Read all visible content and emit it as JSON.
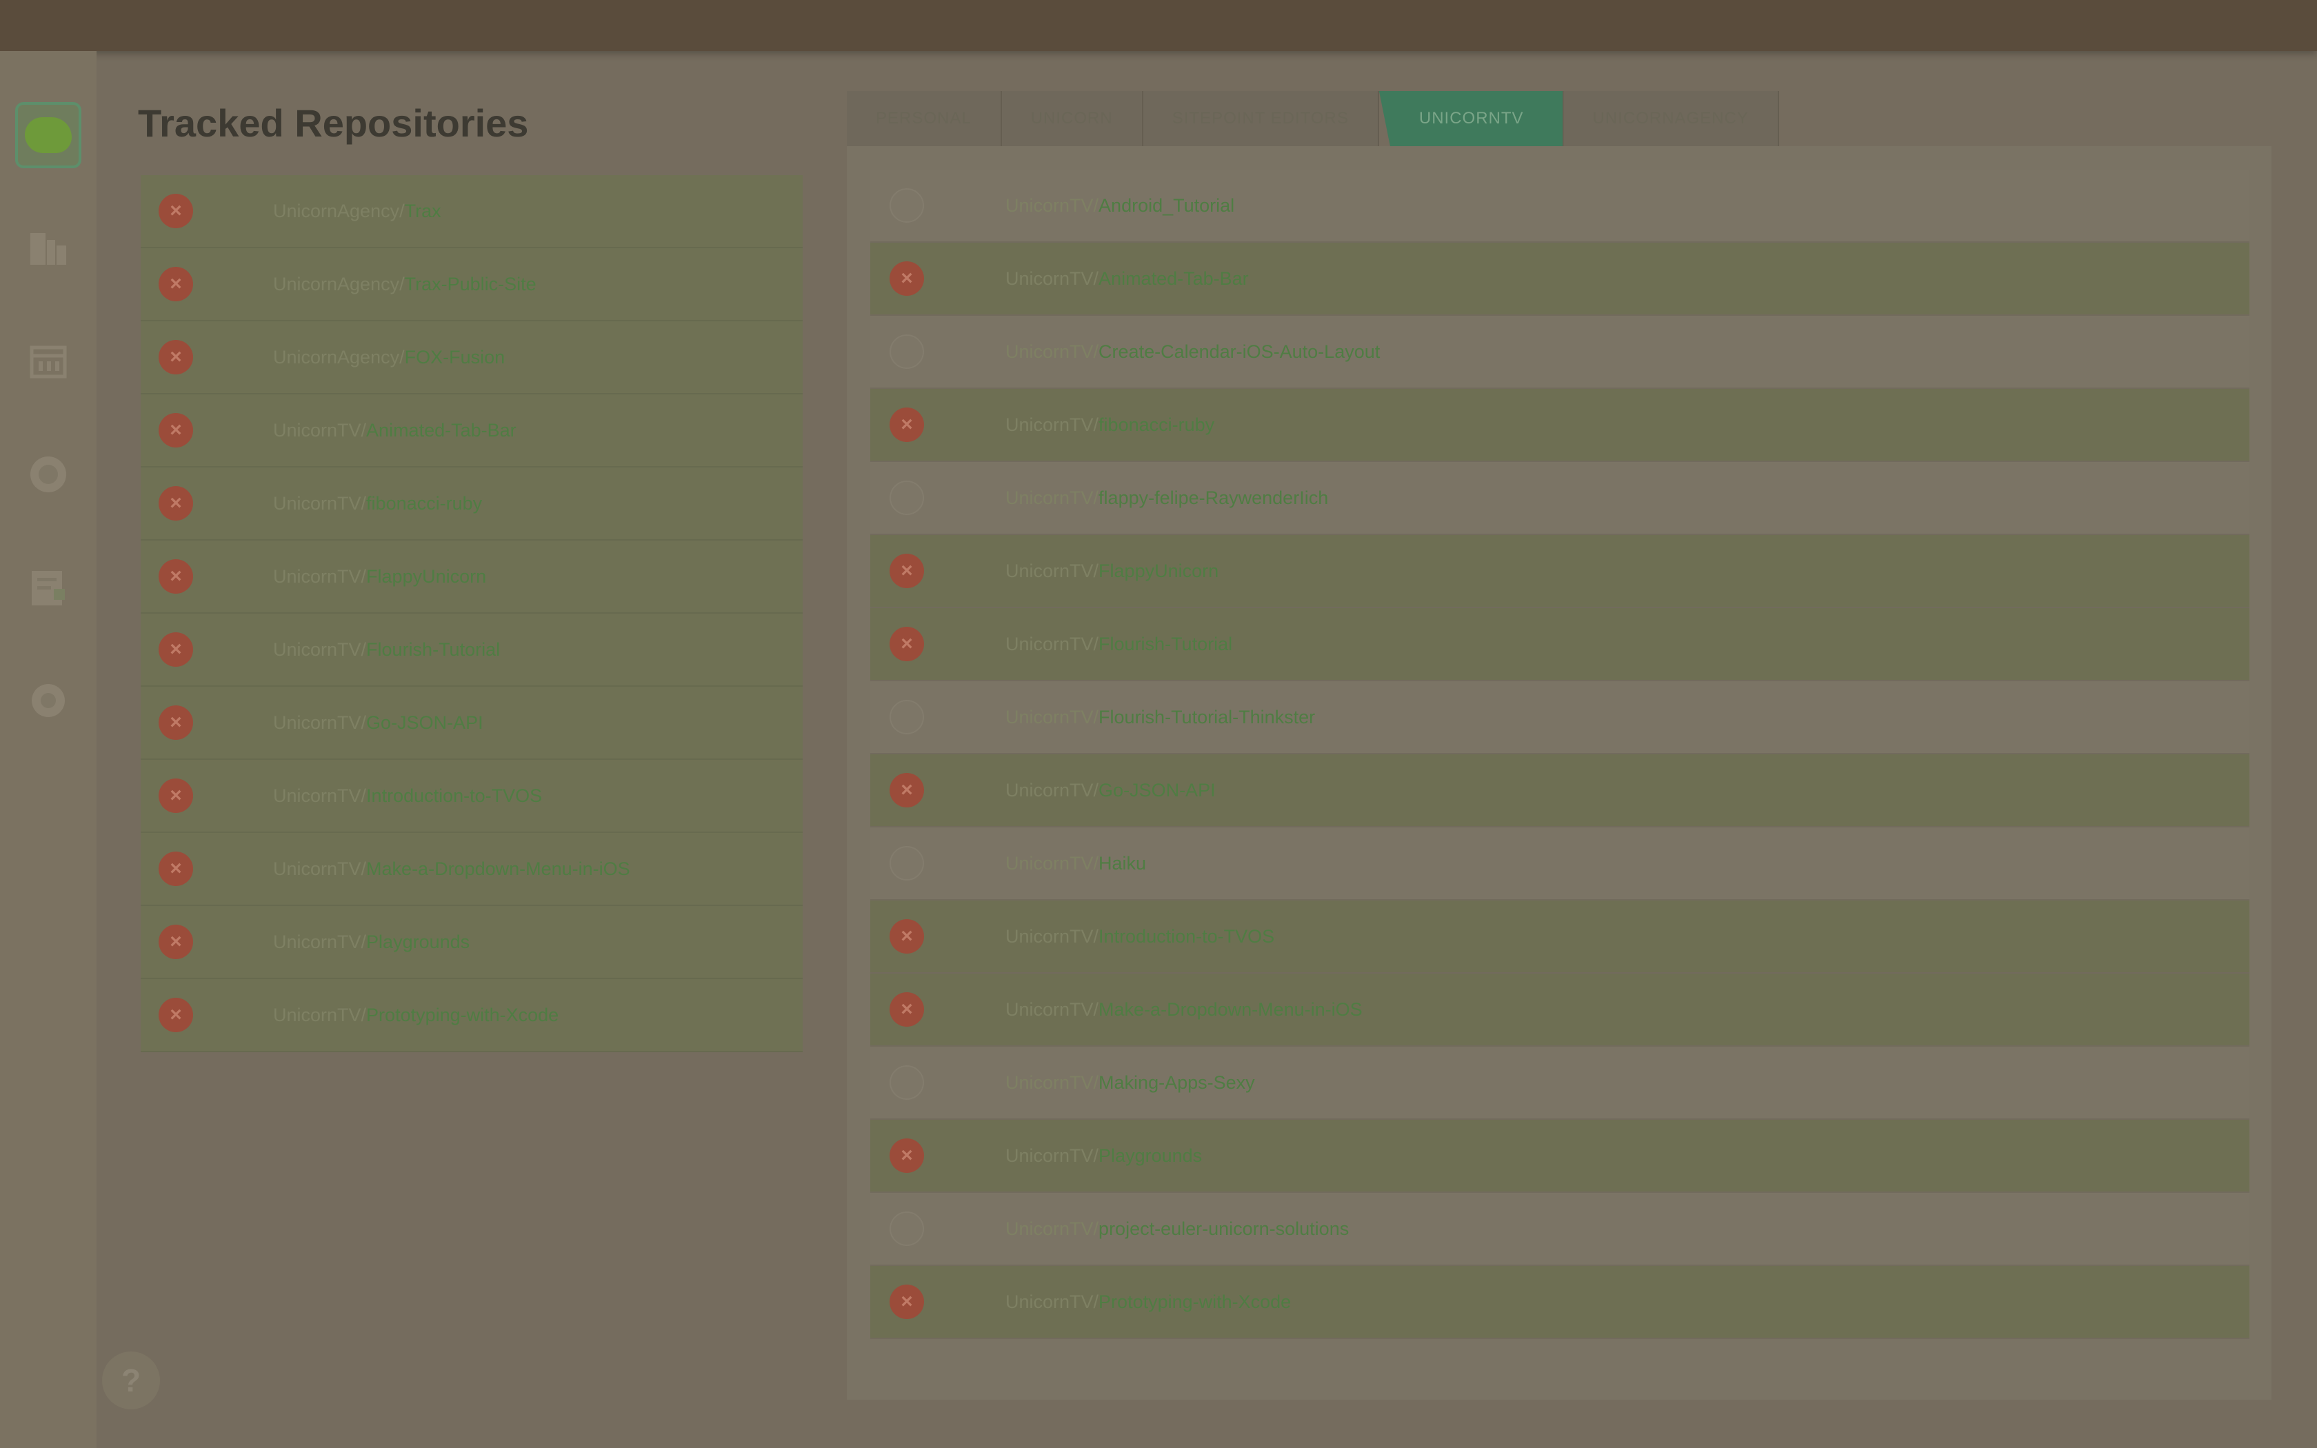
{
  "header": {
    "title": "Tracked Repositories"
  },
  "help": {
    "label": "?"
  },
  "tabs": [
    {
      "label": "PERSONAL",
      "active": false
    },
    {
      "label": "UNICORN",
      "active": false
    },
    {
      "label": "SITEPOINT EDITORS",
      "active": false
    },
    {
      "label": "UNICORNTV",
      "active": true
    },
    {
      "label": "UNICORNAGENCY",
      "active": false
    }
  ],
  "tracked": [
    {
      "owner": "UnicornAgency/",
      "name": "Trax"
    },
    {
      "owner": "UnicornAgency/",
      "name": "Trax-Public-Site"
    },
    {
      "owner": "UnicornAgency/",
      "name": "FOX-Fusion"
    },
    {
      "owner": "UnicornTV/",
      "name": "Animated-Tab-Bar"
    },
    {
      "owner": "UnicornTV/",
      "name": "fibonacci-ruby"
    },
    {
      "owner": "UnicornTV/",
      "name": "FlappyUnicorn"
    },
    {
      "owner": "UnicornTV/",
      "name": "Flourish-Tutorial"
    },
    {
      "owner": "UnicornTV/",
      "name": "Go-JSON-API"
    },
    {
      "owner": "UnicornTV/",
      "name": "Introduction-to-TVOS"
    },
    {
      "owner": "UnicornTV/",
      "name": "Make-a-Dropdown-Menu-in-iOS"
    },
    {
      "owner": "UnicornTV/",
      "name": "Playgrounds"
    },
    {
      "owner": "UnicornTV/",
      "name": "Prototyping-with-Xcode"
    }
  ],
  "repos": [
    {
      "owner": "UnicornTV/",
      "name": "Android_Tutorial",
      "tracked": false
    },
    {
      "owner": "UnicornTV/",
      "name": "Animated-Tab-Bar",
      "tracked": true
    },
    {
      "owner": "UnicornTV/",
      "name": "Create-Calendar-iOS-Auto-Layout",
      "tracked": false
    },
    {
      "owner": "UnicornTV/",
      "name": "fibonacci-ruby",
      "tracked": true
    },
    {
      "owner": "UnicornTV/",
      "name": "flappy-felipe-RaywenderIich",
      "tracked": false
    },
    {
      "owner": "UnicornTV/",
      "name": "FlappyUnicorn",
      "tracked": true
    },
    {
      "owner": "UnicornTV/",
      "name": "Flourish-Tutorial",
      "tracked": true
    },
    {
      "owner": "UnicornTV/",
      "name": "Flourish-Tutorial-Thinkster",
      "tracked": false
    },
    {
      "owner": "UnicornTV/",
      "name": "Go-JSON-API",
      "tracked": true
    },
    {
      "owner": "UnicornTV/",
      "name": "Haiku",
      "tracked": false
    },
    {
      "owner": "UnicornTV/",
      "name": "Introduction-to-TVOS",
      "tracked": true
    },
    {
      "owner": "UnicornTV/",
      "name": "Make-a-Dropdown-Menu-in-iOS",
      "tracked": true
    },
    {
      "owner": "UnicornTV/",
      "name": "Making-Apps-Sexy",
      "tracked": false
    },
    {
      "owner": "UnicornTV/",
      "name": "Playgrounds",
      "tracked": true
    },
    {
      "owner": "UnicornTV/",
      "name": "project-euler-unicorn-solutions",
      "tracked": false
    },
    {
      "owner": "UnicornTV/",
      "name": "Prototyping-with-Xcode",
      "tracked": true
    }
  ],
  "icons": {
    "remove": "close-circle-icon",
    "rail": [
      "logo-icon",
      "repositories-icon",
      "calendar-icon",
      "globe-icon",
      "notes-icon",
      "settings-icon"
    ]
  },
  "colors": {
    "accent": "#3f7a5c",
    "remove": "#9b4c3a",
    "repo_name": "#4f7d43"
  },
  "remove_glyph": "×"
}
